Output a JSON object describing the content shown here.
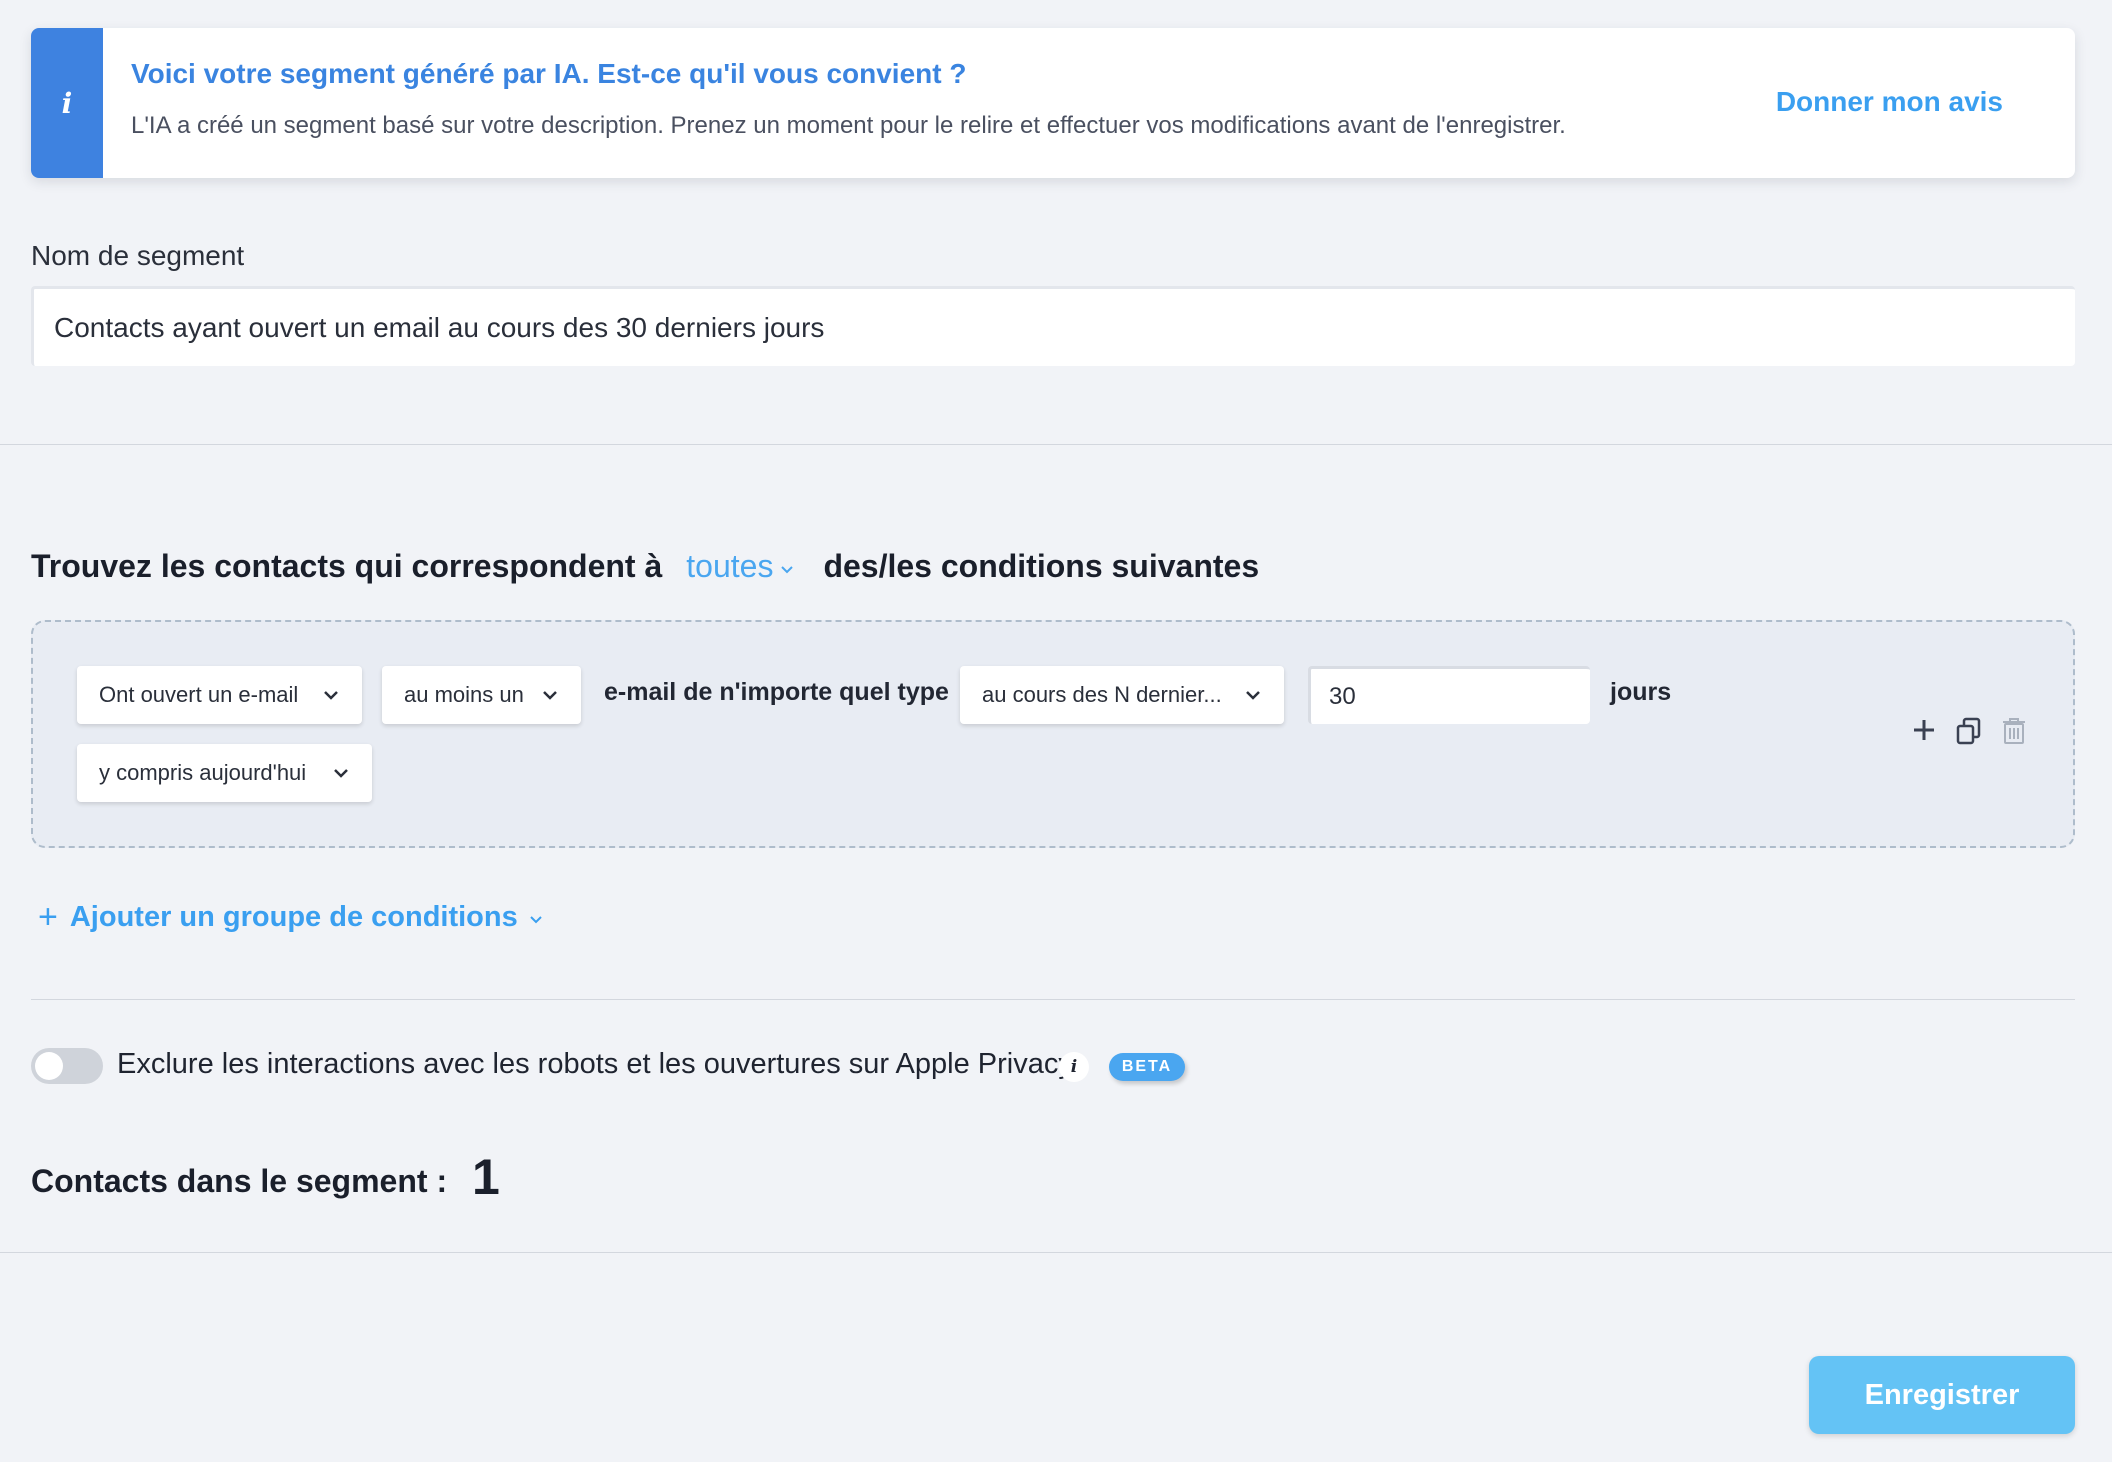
{
  "banner": {
    "icon": "info-icon",
    "title": "Voici votre segment généré par IA. Est-ce qu'il vous convient ?",
    "text": "L'IA a créé un segment basé sur votre description. Prenez un moment pour le relire et effectuer vos modifications avant de l'enregistrer.",
    "feedback_link": "Donner mon avis"
  },
  "segment_name": {
    "label": "Nom de segment",
    "value": "Contacts ayant ouvert un email au cours des 30 derniers jours"
  },
  "conditions": {
    "heading_before": "Trouvez les contacts qui correspondent à",
    "match_mode": "toutes",
    "heading_after": "des/les conditions suivantes",
    "group": {
      "action_dropdown": "Ont ouvert un e-mail",
      "quantity_dropdown": "au moins un",
      "email_type_text": "e-mail de n'importe quel type",
      "period_dropdown": "au cours des N dernier...",
      "days_value": "30",
      "days_unit": "jours",
      "include_today_dropdown": "y compris aujourd'hui"
    },
    "add_group_label": "Ajouter un groupe de conditions"
  },
  "exclude": {
    "toggle_on": false,
    "label": "Exclure les interactions avec les robots et les ouvertures sur Apple Privacy",
    "info_icon": "info-icon",
    "badge": "BETA"
  },
  "count": {
    "label": "Contacts dans le segment :",
    "value": "1"
  },
  "save_button": "Enregistrer",
  "colors": {
    "accent": "#3e82e0",
    "link": "#3a9ff0",
    "save": "#64c3f5",
    "background": "#f1f3f7"
  }
}
